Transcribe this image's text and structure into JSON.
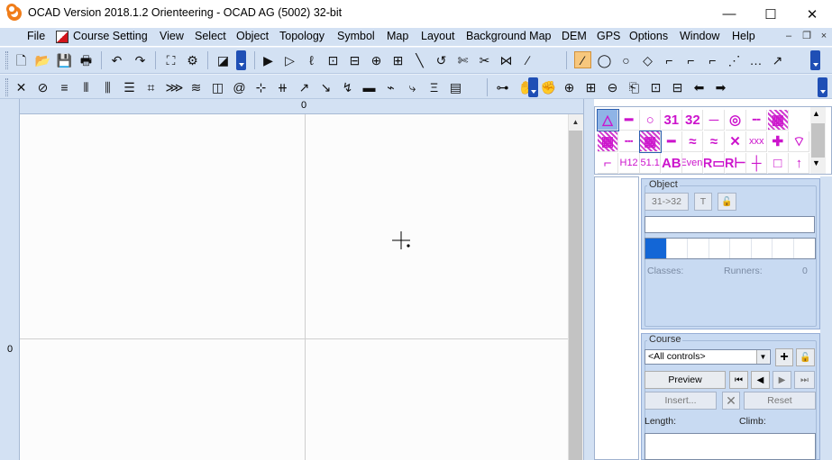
{
  "window": {
    "title": "OCAD Version 2018.1.2  Orienteering - OCAD AG (5002) 32-bit",
    "controls": {
      "minimize": "—",
      "maximize": "☐",
      "close": "✕"
    }
  },
  "menu": {
    "items": [
      "File",
      "Course Setting",
      "View",
      "Select",
      "Object",
      "Topology",
      "Symbol",
      "Map",
      "Layout",
      "Background Map",
      "DEM",
      "GPS",
      "Options",
      "Window",
      "Help"
    ],
    "mdi": {
      "minimize": "–",
      "restore": "❐",
      "close": "×"
    }
  },
  "toolbar1": {
    "icons": [
      "new-file-icon",
      "open-folder-icon",
      "save-icon",
      "print-icon",
      "undo-icon",
      "redo-icon",
      "fullscreen-icon",
      "preview-icon",
      "fill-icon",
      "pointer-icon",
      "edit-point-icon",
      "lasso-icon",
      "add-vertex-icon",
      "delete-vertex-icon",
      "move-vertex-icon",
      "rotate-vertex-icon",
      "cut-icon",
      "arc-icon",
      "scissors-icon",
      "scissors-alt-icon",
      "join-icon",
      "line-icon",
      "curve-mode-icon",
      "ellipse-mode-icon",
      "circle-mode-icon",
      "rectangle-mode-icon",
      "freehand-icon",
      "straight-mode-icon",
      "angular-mode-icon",
      "dashed-mode-icon",
      "dotted-mode-icon",
      "number-mode-icon"
    ],
    "glyphs": [
      "🗋",
      "📂",
      "💾",
      "🖶",
      "↶",
      "↷",
      "⛶",
      "⚙",
      "◪",
      "▶",
      "▷",
      "ℓ",
      "⊡",
      "⊟",
      "⊕",
      "⊞",
      "╲",
      "↺",
      "✄",
      "✂",
      "⋈",
      "∕",
      "⁄",
      "◯",
      "○",
      "◇",
      "⌐",
      "⌐",
      "⌐",
      "⋰",
      "…",
      "↗"
    ]
  },
  "toolbar2": {
    "icons": [
      "fan-icon",
      "check-icon",
      "align-left-icon",
      "barcode-icon",
      "bars-icon",
      "stack-icon",
      "crop-icon",
      "pattern-icon",
      "wave-icon",
      "layers-icon",
      "spiral-icon",
      "split-icon",
      "hashmark-icon",
      "arrow-up-icon",
      "arrow-down-icon",
      "sweep-icon",
      "eraser-icon",
      "reshape-icon",
      "step-icon",
      "bold-step-icon",
      "grid-icon",
      "binoculars-icon",
      "pan-hand-icon",
      "grab-hand-icon",
      "zoom-in-icon",
      "zoom-rect-icon",
      "zoom-out-icon",
      "zoom-page-icon",
      "zoom-fit-icon",
      "zoom-all-icon",
      "back-arrow-icon",
      "forward-arrow-icon"
    ],
    "glyphs": [
      "✕",
      "⊘",
      "≡",
      "⦀",
      "⫼",
      "☰",
      "⌗",
      "⋙",
      "≋",
      "◫",
      "@",
      "⊹",
      "⧺",
      "↗",
      "↘",
      "↯",
      "▬",
      "⌁",
      "⤷",
      "Ξ",
      "▤",
      "⊶",
      "✋",
      "✊",
      "⊕",
      "⊞",
      "⊖",
      "⎗",
      "⊡",
      "⊟",
      "⬅",
      "➡"
    ]
  },
  "map": {
    "ruler_top_label": "0",
    "ruler_left_label": "0"
  },
  "symbols": {
    "row1": [
      "△",
      "━",
      "○",
      "31",
      "32",
      "─",
      "◎",
      "╌",
      "▦"
    ],
    "row2": [
      "▦",
      "┄",
      "▦",
      "━",
      "≈",
      "≈",
      "✕",
      "xxx",
      "✚",
      "⌔"
    ],
    "row3": [
      "⌐",
      "H12",
      "51.1",
      "AB",
      "Event",
      "R▭",
      "R⊢",
      "┼",
      "□",
      "↑"
    ]
  },
  "object_panel": {
    "title": "Object",
    "btn_number": "31->32",
    "btn_text": "T",
    "lock_icon": "🔓",
    "classes_label": "Classes:",
    "runners_label": "Runners:",
    "runners_value": "0"
  },
  "course_panel": {
    "title": "Course",
    "select_value": "<All controls>",
    "add_icon": "+",
    "lock_icon": "🔓",
    "preview": "Preview",
    "nav": {
      "first": "⏮",
      "prev": "◀",
      "next": "▶",
      "last": "⏭"
    },
    "insert": "Insert...",
    "delete_icon": "✕",
    "reset": "Reset",
    "length_label": "Length:",
    "climb_label": "Climb:"
  }
}
